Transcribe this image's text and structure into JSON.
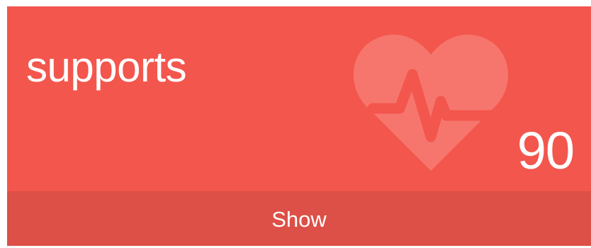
{
  "card": {
    "title": "supports",
    "count": "90",
    "icon": "heartbeat-icon",
    "footer_label": "Show"
  },
  "colors": {
    "card_background": "#f3564d",
    "footer_background": "#dc5047",
    "icon_fill": "#f6766d",
    "text": "#ffffff"
  }
}
